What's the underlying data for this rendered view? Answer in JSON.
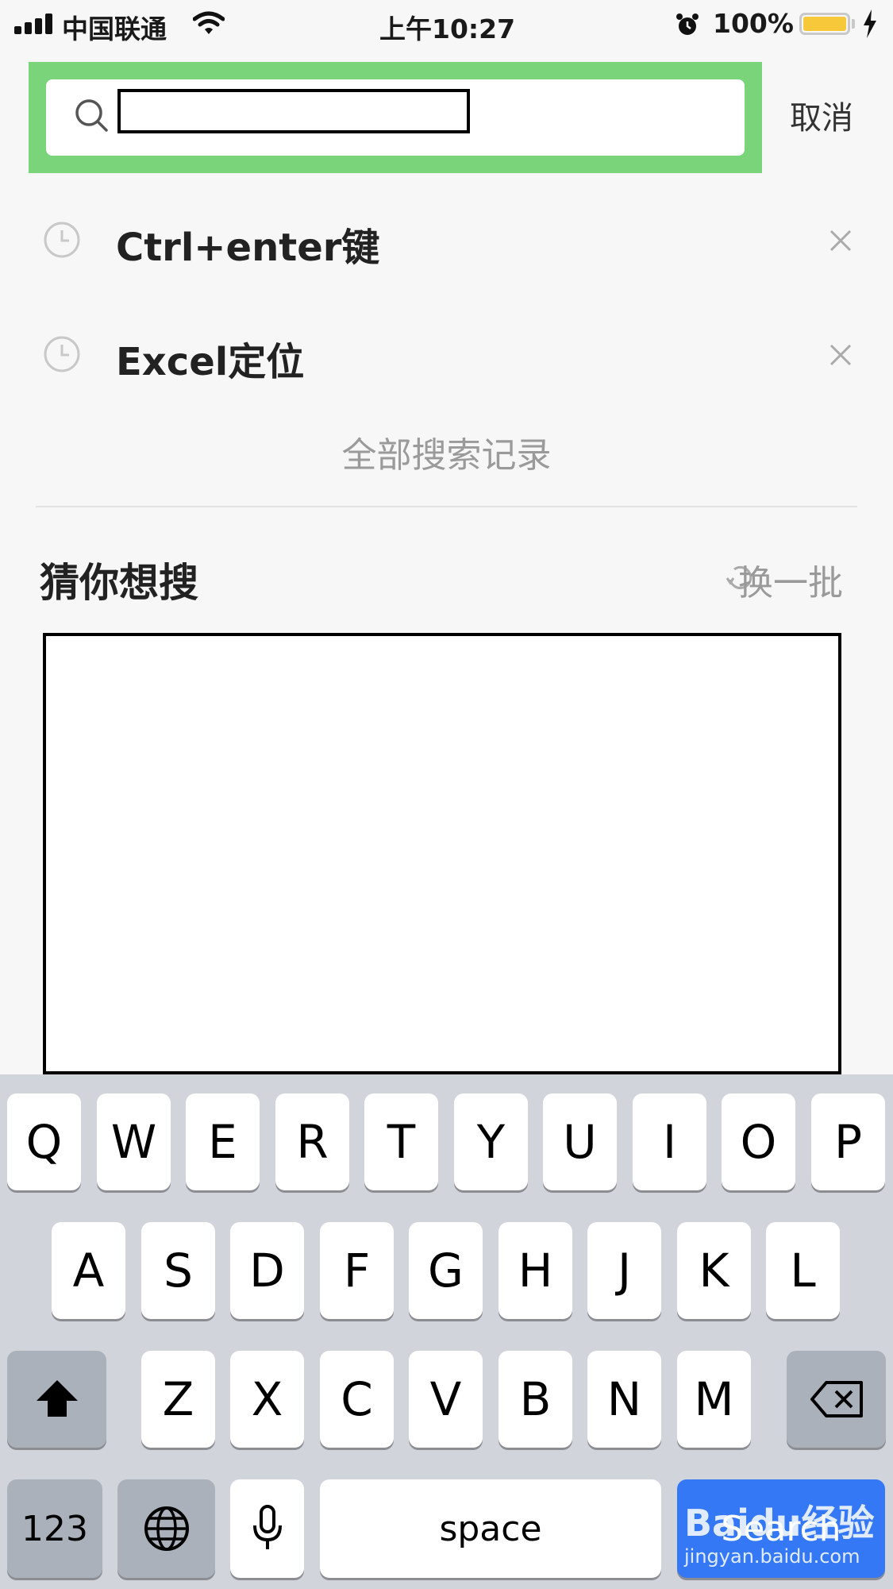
{
  "status_bar": {
    "carrier": "中国联通",
    "time": "上午10:27",
    "battery": "100%"
  },
  "search": {
    "value": "",
    "placeholder": "",
    "cancel_label": "取消"
  },
  "history": {
    "items": [
      {
        "text": "Ctrl+enter键"
      },
      {
        "text": "Excel定位"
      }
    ],
    "all_label": "全部搜索记录"
  },
  "guess": {
    "title": "猜你想搜",
    "refresh_label": "换一批"
  },
  "keyboard": {
    "row1": [
      "Q",
      "W",
      "E",
      "R",
      "T",
      "Y",
      "U",
      "I",
      "O",
      "P"
    ],
    "row2": [
      "A",
      "S",
      "D",
      "F",
      "G",
      "H",
      "J",
      "K",
      "L"
    ],
    "row3": [
      "Z",
      "X",
      "C",
      "V",
      "B",
      "N",
      "M"
    ],
    "numbers_label": "123",
    "space_label": "space",
    "search_label": "Search"
  },
  "watermark": {
    "brand": "Baidu经验",
    "url": "jingyan.baidu.com"
  },
  "colors": {
    "highlight": "#7ad47a",
    "battery": "#f7c83a",
    "search_key": "#3478f6"
  }
}
